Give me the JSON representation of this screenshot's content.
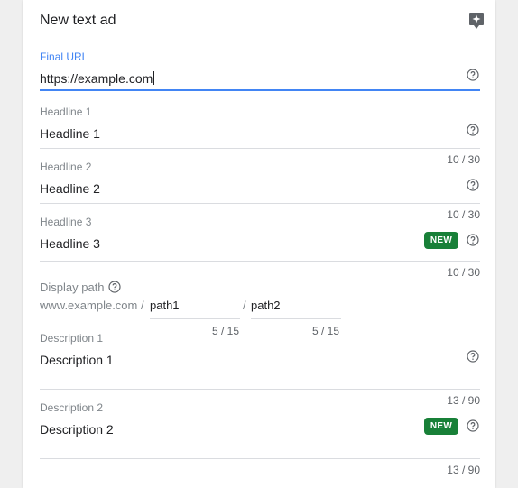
{
  "form": {
    "title": "New text ad",
    "final_url": {
      "label": "Final URL",
      "value": "https://example.com"
    },
    "headline1": {
      "label": "Headline 1",
      "value": "Headline 1",
      "counter": "10 / 30"
    },
    "headline2": {
      "label": "Headline 2",
      "value": "Headline 2",
      "counter": "10 / 30"
    },
    "headline3": {
      "label": "Headline 3",
      "value": "Headline 3",
      "badge": "NEW",
      "counter": "10 / 30"
    },
    "display_path": {
      "label": "Display path",
      "domain": "www.example.com /",
      "path1": "path1",
      "separator": "/",
      "path2": "path2",
      "path1_counter": "5 / 15",
      "path2_counter": "5 / 15"
    },
    "description1": {
      "label": "Description 1",
      "value": "Description 1",
      "counter": "13 / 90"
    },
    "description2": {
      "label": "Description 2",
      "value": "Description 2",
      "badge": "NEW",
      "counter": "13 / 90"
    }
  },
  "colors": {
    "accent": "#4285f4",
    "badge": "#188038",
    "divider": "#dadce0"
  },
  "icons": [
    "lightbulb-icon",
    "help-icon"
  ]
}
